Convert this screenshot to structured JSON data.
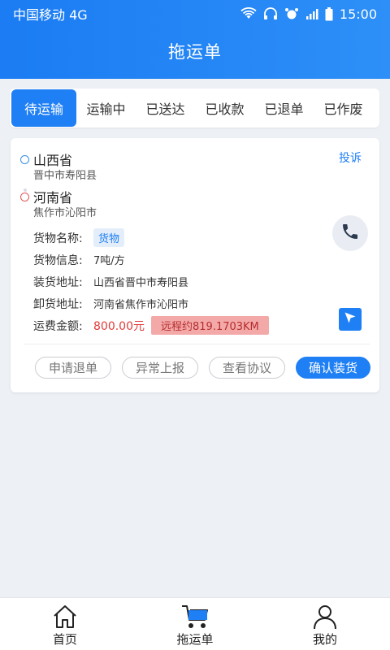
{
  "status_bar": {
    "carrier": "中国移动 4G",
    "time": "15:00",
    "icons": [
      "wifi-icon",
      "headphone-icon",
      "alarm-icon",
      "signal-icon",
      "battery-icon"
    ]
  },
  "header": {
    "title": "拖运单"
  },
  "tabs": [
    {
      "label": "待运输",
      "active": true
    },
    {
      "label": "运输中",
      "active": false
    },
    {
      "label": "已送达",
      "active": false
    },
    {
      "label": "已收款",
      "active": false
    },
    {
      "label": "已退单",
      "active": false
    },
    {
      "label": "已作废",
      "active": false
    }
  ],
  "order": {
    "origin": {
      "province": "山西省",
      "city": "晋中市寿阳县"
    },
    "destination": {
      "province": "河南省",
      "city": "焦作市沁阳市"
    },
    "complain_label": "投诉",
    "goods_name_label": "货物名称:",
    "goods_name": "货物",
    "goods_info_label": "货物信息:",
    "goods_info": "7吨/方",
    "load_address_label": "装货地址:",
    "load_address": "山西省晋中市寿阳县",
    "unload_address_label": "卸货地址:",
    "unload_address": "河南省焦作市沁阳市",
    "fee_label": "运费金额:",
    "fee": "800.00元",
    "distance": "远程约819.1703KM",
    "actions": {
      "refund": "申请退单",
      "report": "异常上报",
      "agreement": "查看协议",
      "confirm": "确认装货"
    }
  },
  "bottom_nav": [
    {
      "label": "首页",
      "icon": "home-icon"
    },
    {
      "label": "拖运单",
      "icon": "cart-icon"
    },
    {
      "label": "我的",
      "icon": "user-icon"
    }
  ],
  "colors": {
    "primary": "#1f7ff4",
    "fee": "#e33a3a",
    "distance_bg": "#f4a9a9"
  }
}
